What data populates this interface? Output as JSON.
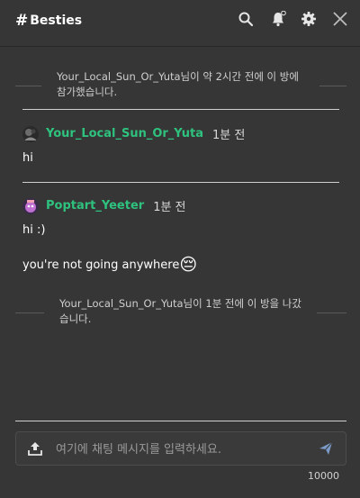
{
  "header": {
    "hash": "#",
    "channel_name": "Besties",
    "icons": [
      "search-icon",
      "bell-icon",
      "gear-icon",
      "close-icon"
    ]
  },
  "messages": {
    "system_join": "Your_Local_Sun_Or_Yuta님이 약 2시간 전에 이 방에 참가했습니다.",
    "post1": {
      "username": "Your_Local_Sun_Or_Yuta",
      "time": "1분 전",
      "text": "hi"
    },
    "post2": {
      "username": "Poptart_Yeeter",
      "time": "1분 전",
      "text1": "hi :)",
      "text2": "you're not going anywhere",
      "emoji": "😔"
    },
    "system_leave": "Your_Local_Sun_Or_Yuta님이 1분 전에 이 방을 나갔습니다."
  },
  "composer": {
    "placeholder": "여기에 채팅 메시지를 입력하세요.",
    "char_limit": "10000"
  },
  "colors": {
    "background": "#363636",
    "username": "#2ec27e"
  }
}
